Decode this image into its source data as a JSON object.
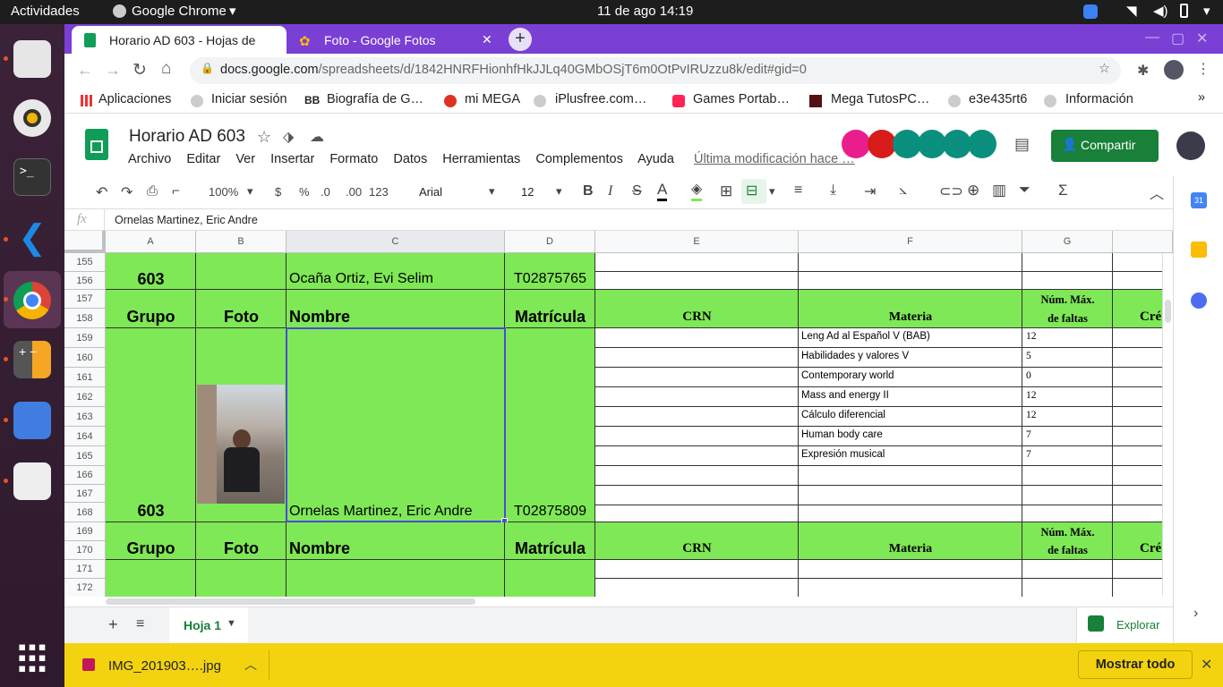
{
  "topbar": {
    "activities": "Actividades",
    "app": "Google Chrome",
    "datetime": "11 de ago  14:19"
  },
  "tabs": [
    {
      "title": "Horario AD 603 - Hojas de"
    },
    {
      "title": "Foto - Google Fotos"
    }
  ],
  "omnibox": {
    "domain": "docs.google.com",
    "path": "/spreadsheets/d/1842HNRFHionhfHkJJLq40GMbOSjT6m0OtPvIRUzzu8k/edit#gid=0"
  },
  "bookmarks": [
    "Aplicaciones",
    "Iniciar sesión",
    "Biografía de G…",
    "mi MEGA",
    "iPlusfree.com…",
    "Games Portab…",
    "Mega TutosPC…",
    "e3e435rt6",
    "Información"
  ],
  "doc": {
    "title": "Horario AD 603",
    "share": "Compartir",
    "last_mod": "Última modificación hace …",
    "menu": [
      "Archivo",
      "Editar",
      "Ver",
      "Insertar",
      "Formato",
      "Datos",
      "Herramientas",
      "Complementos",
      "Ayuda"
    ]
  },
  "toolbar": {
    "zoom": "100%",
    "currency": "$",
    "percent": "%",
    "dec_minus": ".0",
    "dec_plus": ".00",
    "more_formats": "123",
    "font": "Arial",
    "size": "12"
  },
  "formula": {
    "fx": "fx",
    "value": "Ornelas Martinez, Eric Andre"
  },
  "columns": [
    "A",
    "B",
    "C",
    "D",
    "E",
    "F",
    "G"
  ],
  "rows": [
    "155",
    "156",
    "157",
    "158",
    "159",
    "160",
    "161",
    "162",
    "163",
    "164",
    "165",
    "166",
    "167",
    "168",
    "169",
    "170",
    "171",
    "172"
  ],
  "sheet": {
    "headers": {
      "grupo": "Grupo",
      "foto": "Foto",
      "nombre": "Nombre",
      "matricula": "Matrícula",
      "crn": "CRN",
      "materia": "Materia",
      "nummax1": "Núm. Máx.",
      "nummax2": "de faltas",
      "creditos": "Cré"
    },
    "rec1": {
      "grupo": "603",
      "nombre": "Ocaña Ortiz, Evi Selim",
      "matricula": "T02875765"
    },
    "rec2": {
      "grupo": "603",
      "nombre": "Ornelas Martinez, Eric Andre",
      "matricula": "T02875809"
    },
    "subjects": [
      {
        "materia": "Leng Ad al Español V (BAB)",
        "faltas": "12"
      },
      {
        "materia": "Habilidades y valores V",
        "faltas": "5"
      },
      {
        "materia": "Contemporary world",
        "faltas": "0"
      },
      {
        "materia": "Mass and energy II",
        "faltas": "12"
      },
      {
        "materia": "Cálculo diferencial",
        "faltas": "12"
      },
      {
        "materia": "Human body care",
        "faltas": "7"
      },
      {
        "materia": "Expresión musical",
        "faltas": "7"
      }
    ]
  },
  "sheettab": "Hoja 1",
  "explore": "Explorar",
  "download": {
    "file": "IMG_201903….jpg",
    "showall": "Mostrar todo"
  },
  "colors": {
    "cell_green": "#7fe856",
    "chrome_purple": "#7a3fd4",
    "sheets_green": "#188038",
    "download_yellow": "#f3d30f"
  }
}
